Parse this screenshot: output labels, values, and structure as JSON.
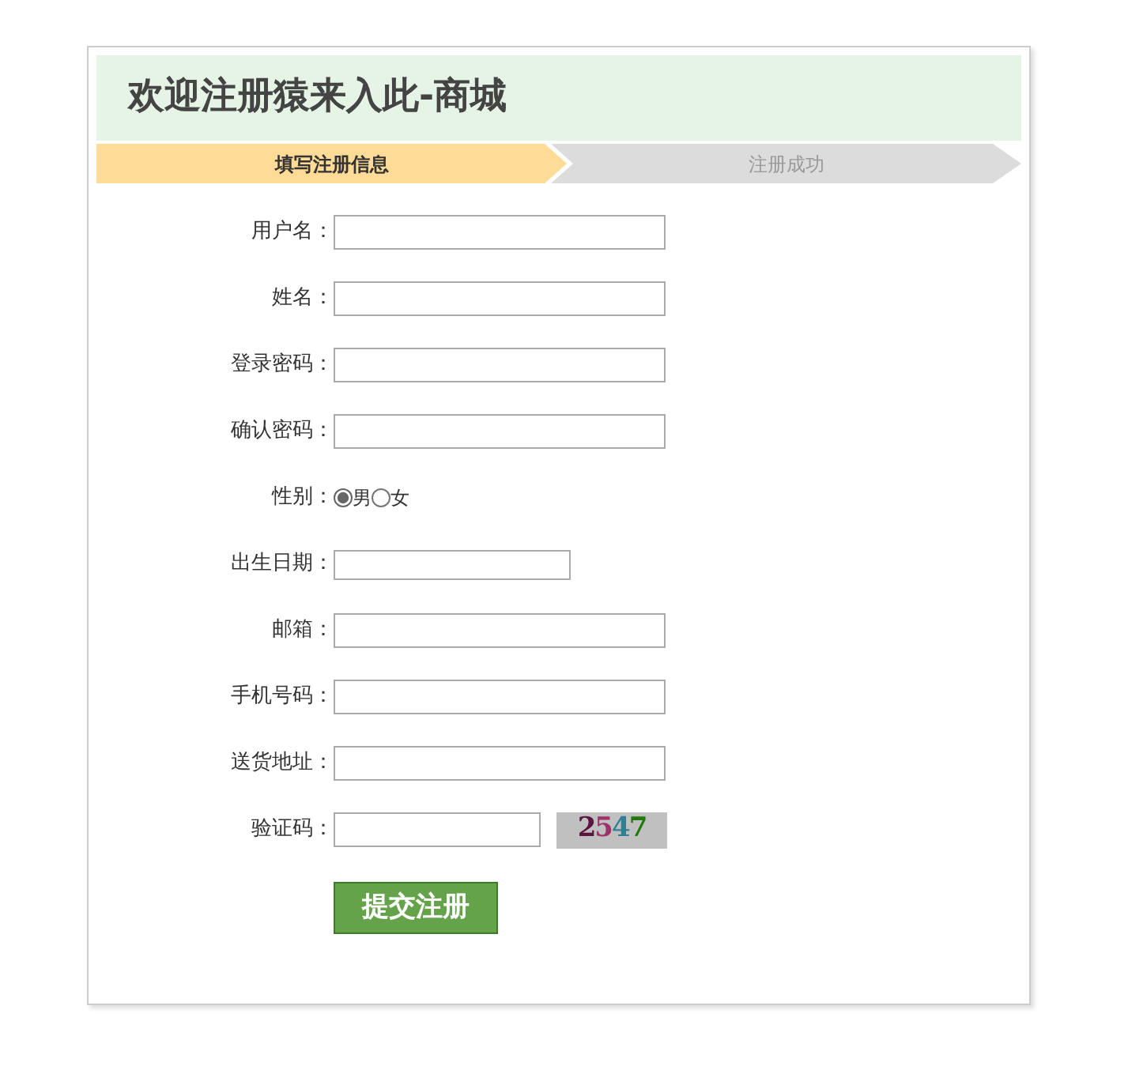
{
  "header": {
    "title": "欢迎注册猿来入此-商城"
  },
  "steps": [
    {
      "label": "填写注册信息",
      "selected": true
    },
    {
      "label": "注册成功",
      "selected": false
    }
  ],
  "fields": [
    {
      "kind": "text",
      "label": "用户名："
    },
    {
      "kind": "text",
      "label": "姓名："
    },
    {
      "kind": "text",
      "label": "登录密码："
    },
    {
      "kind": "text",
      "label": "确认密码："
    },
    {
      "kind": "radio",
      "label": "性别：",
      "options": [
        {
          "label": "男",
          "selected": true
        },
        {
          "label": "女",
          "selected": false
        }
      ]
    },
    {
      "kind": "date",
      "label": "出生日期："
    },
    {
      "kind": "text",
      "label": "邮箱："
    },
    {
      "kind": "text",
      "label": "手机号码："
    },
    {
      "kind": "text",
      "label": "送货地址："
    },
    {
      "kind": "captcha",
      "label": "验证码：",
      "captcha": [
        {
          "char": "2",
          "color": "#5a1640"
        },
        {
          "char": "5",
          "color": "#a0306a"
        },
        {
          "char": "4",
          "color": "#2f7f95"
        },
        {
          "char": "7",
          "color": "#1f7a0c"
        }
      ]
    }
  ],
  "submit": {
    "label": "提交注册"
  }
}
